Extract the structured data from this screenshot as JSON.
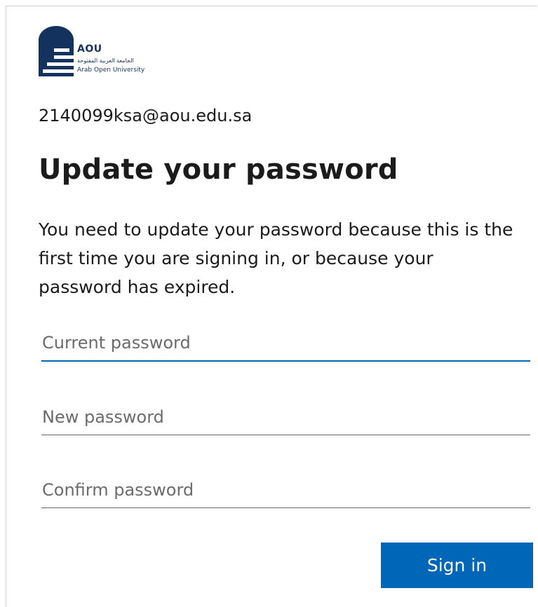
{
  "logo": {
    "icon": "aou-building-logo",
    "acronym": "AOU",
    "arabic_name": "الجامعة العربية المفتوحة",
    "english_name": "Arab Open University",
    "color": "#14325e"
  },
  "user": {
    "email": "2140099ksa@aou.edu.sa"
  },
  "form": {
    "title": "Update your password",
    "description": "You need to update your password because this is the first time you are signing in, or because your password has expired.",
    "current_password": {
      "value": "",
      "placeholder": "Current password"
    },
    "new_password": {
      "value": "",
      "placeholder": "New password"
    },
    "confirm_password": {
      "value": "",
      "placeholder": "Confirm password"
    },
    "submit_label": "Sign in"
  },
  "colors": {
    "accent": "#0067b8",
    "text": "#1b1b1b",
    "placeholder": "#6b6b6b"
  }
}
